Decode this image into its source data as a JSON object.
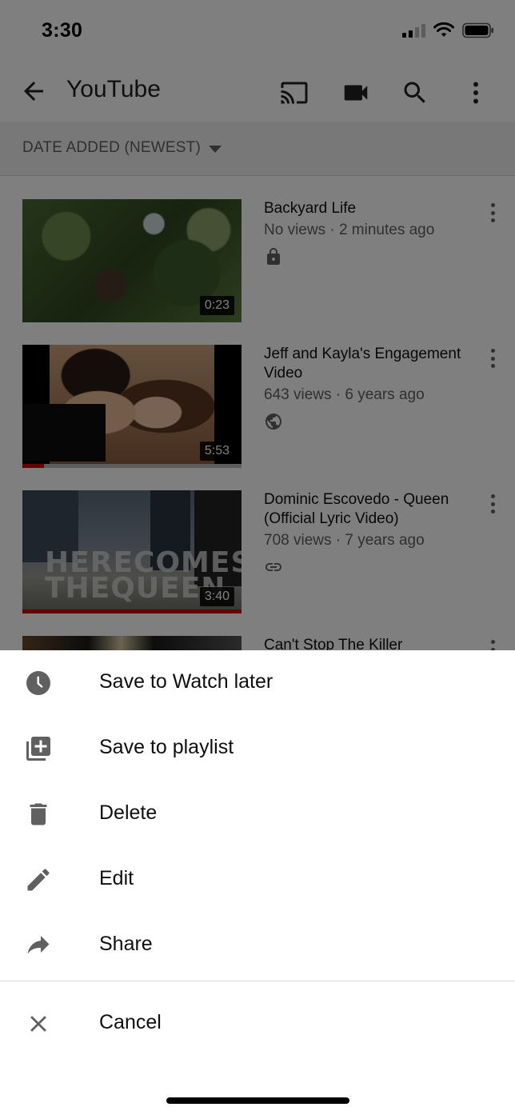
{
  "status_bar": {
    "time": "3:30",
    "signal_bars_active": 2,
    "signal_bars_total": 4,
    "wifi": "wifi-icon",
    "battery": "battery-full-icon"
  },
  "header": {
    "title": "YouTube",
    "back_icon": "arrow-left-icon",
    "actions": [
      {
        "name": "cast",
        "icon": "cast-icon"
      },
      {
        "name": "upload",
        "icon": "video-camera-icon"
      },
      {
        "name": "search",
        "icon": "search-icon"
      },
      {
        "name": "more",
        "icon": "more-vertical-icon"
      }
    ]
  },
  "sort": {
    "label": "DATE ADDED (NEWEST)",
    "icon": "caret-down-icon"
  },
  "videos": [
    {
      "title": "Backyard Life",
      "meta": "No views · 2 minutes ago",
      "duration": "0:23",
      "privacy": "private",
      "privacy_icon": "lock-icon",
      "watch_progress": 0
    },
    {
      "title": "Jeff and Kayla's Engagement Video",
      "meta": "643 views · 6 years ago",
      "duration": "5:53",
      "privacy": "public",
      "privacy_icon": "globe-icon",
      "watch_progress": 0.1
    },
    {
      "title": "Dominic Escovedo - Queen (Official Lyric Video)",
      "meta": "708 views · 7 years ago",
      "duration": "3:40",
      "privacy": "unlisted",
      "privacy_icon": "link-icon",
      "watch_progress": 1.0,
      "thumbnail_text": [
        "HERECOMES",
        "THEQUEEN"
      ]
    },
    {
      "title": "Can't Stop The Killer"
    }
  ],
  "sheet": {
    "items": [
      {
        "label": "Save to Watch later",
        "icon": "clock-icon"
      },
      {
        "label": "Save to playlist",
        "icon": "playlist-add-icon"
      },
      {
        "label": "Delete",
        "icon": "trash-icon"
      },
      {
        "label": "Edit",
        "icon": "pencil-icon"
      },
      {
        "label": "Share",
        "icon": "share-arrow-icon"
      }
    ],
    "cancel": {
      "label": "Cancel",
      "icon": "close-icon"
    }
  },
  "colors": {
    "progress_red": "#cc0000",
    "icon_gray": "#606060",
    "text_primary": "#0f0f0f",
    "scrim": "rgba(0,0,0,0.5)"
  }
}
